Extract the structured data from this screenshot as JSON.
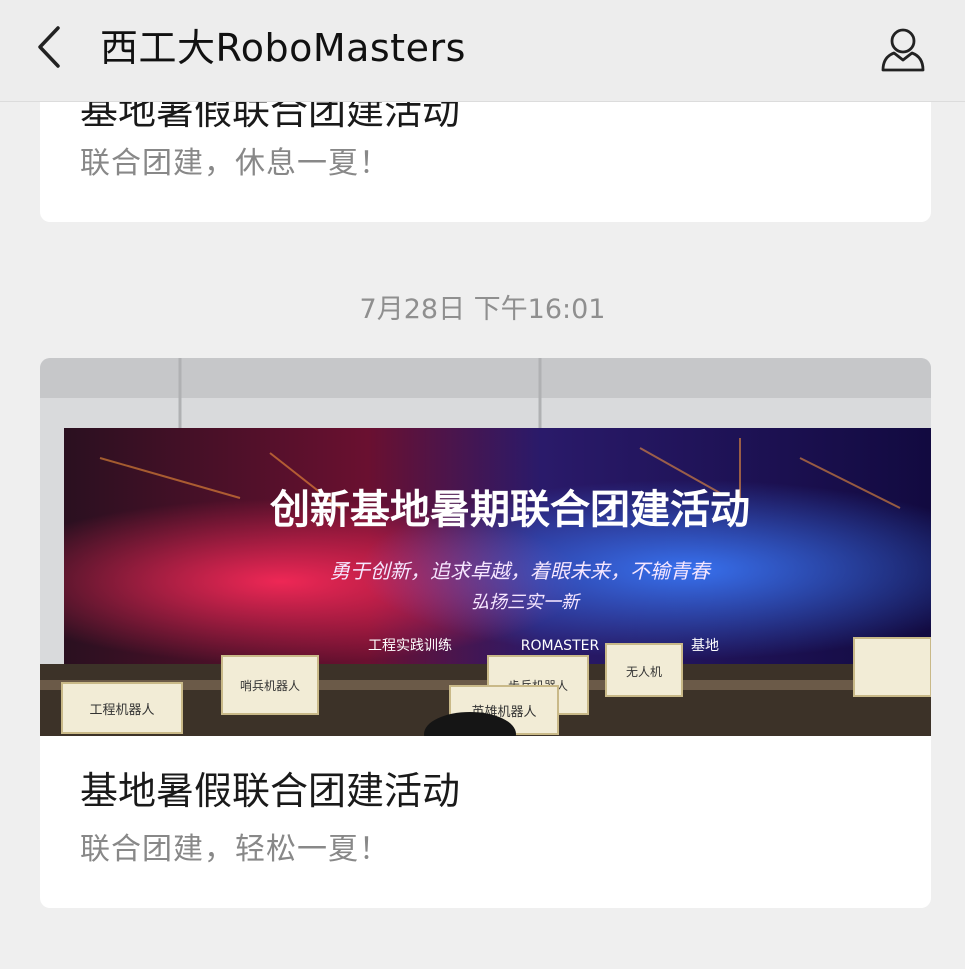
{
  "header": {
    "title": "西工大RoboMasters",
    "back_icon": "chevron-left-icon",
    "profile_icon": "person-icon"
  },
  "previous_article": {
    "title": "基地暑假联合团建活动",
    "summary": "联合团建，休息一夏！"
  },
  "timestamp": "7月28日 下午16:01",
  "article": {
    "cover": {
      "banner_title": "创新基地暑期联合团建活动",
      "slogan_line1": "勇于创新，追求卓越，着眼未来，不输青春",
      "slogan_line2": "弘扬三实一新",
      "footer_left": "工程实践训练",
      "footer_right": "ROMASTER",
      "footer_base": "基地",
      "signs": [
        "工程机器人",
        "哨兵机器人",
        "步兵机器人",
        "英雄机器人",
        "无人机"
      ]
    },
    "title": "基地暑假联合团建活动",
    "summary": "联合团建，轻松一夏！"
  },
  "colors": {
    "nav_bg": "#ededed",
    "page_bg": "#efefef",
    "card_bg": "#ffffff",
    "title_text": "#1a1a1a",
    "muted_text": "#888888"
  }
}
